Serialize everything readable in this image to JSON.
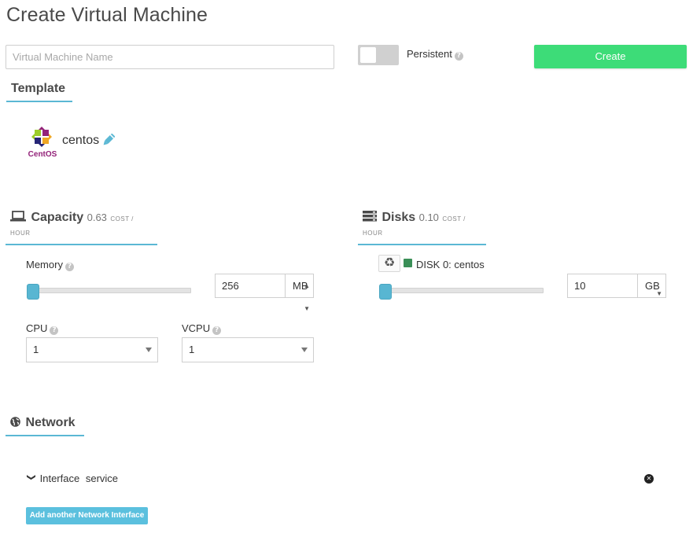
{
  "page": {
    "title": "Create Virtual Machine"
  },
  "vm_name": {
    "placeholder": "Virtual Machine Name",
    "value": ""
  },
  "persistent": {
    "label": "Persistent",
    "enabled": false,
    "icon": "question-circle-icon"
  },
  "create_button": {
    "label": "Create",
    "color": "#3ddc78"
  },
  "template": {
    "heading": "Template",
    "name": "centos",
    "logo_text": "CentOS",
    "icons": [
      "centos-logo-icon",
      "pencil-icon"
    ]
  },
  "capacity": {
    "heading": "Capacity",
    "cost": "0.63",
    "cost_unit": "COST / HOUR",
    "icon": "laptop-icon",
    "memory": {
      "label": "Memory",
      "value": "256",
      "unit": "MB",
      "slider_fraction": 0
    },
    "cpu": {
      "label": "CPU",
      "value": "1"
    },
    "vcpu": {
      "label": "VCPU",
      "value": "1"
    }
  },
  "disks": {
    "heading": "Disks",
    "cost": "0.10",
    "cost_unit": "COST / HOUR",
    "icon": "server-icon",
    "disk0": {
      "label": "DISK 0: centos",
      "value": "10",
      "unit": "GB",
      "slider_fraction": 0,
      "color": "#3a8f57"
    },
    "recycle_icon": "recycle-icon"
  },
  "network": {
    "heading": "Network",
    "icon": "globe-icon",
    "interface_label": "Interface",
    "interface_name": "service",
    "add_button": "Add another Network Interface"
  },
  "colors": {
    "accent": "#5bb8d4",
    "slider": "#58b6d2",
    "add_button": "#5bc0de"
  }
}
